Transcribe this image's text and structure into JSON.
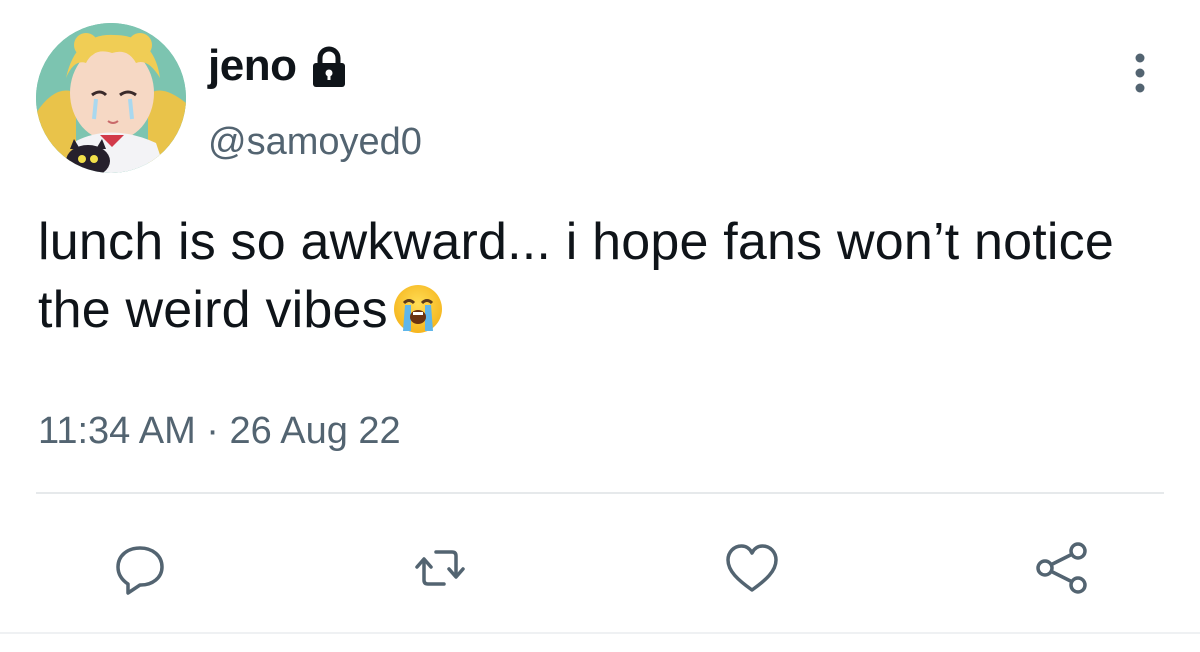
{
  "tweet": {
    "display_name": "jeno",
    "handle": "@samoyed0",
    "text": "lunch is so awkward... i hope fans won’t notice the weird vibes",
    "emoji": "loudly-crying-face",
    "time": "11:34 AM",
    "separator": "·",
    "date": "26 Aug 22",
    "protected": true
  },
  "icons": {
    "lock": "lock-icon",
    "more": "more-vertical-icon",
    "reply": "reply-icon",
    "retweet": "retweet-icon",
    "like": "heart-icon",
    "share": "share-icon"
  },
  "colors": {
    "text": "#0f1419",
    "secondary": "#536471",
    "divider": "#e6e9eb"
  }
}
